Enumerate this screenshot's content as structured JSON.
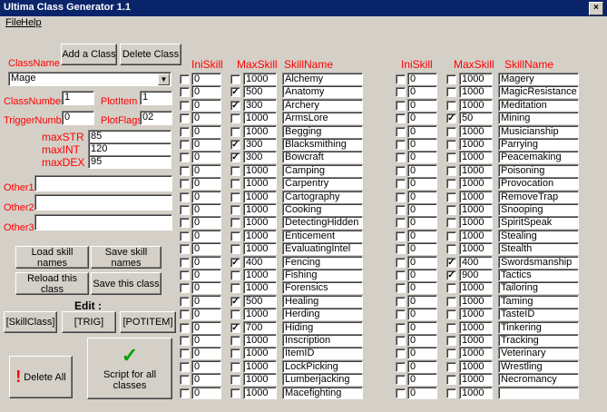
{
  "window": {
    "title": "Ultima Class Generator 1.1",
    "close_glyph": "×"
  },
  "menu": {
    "file": "File",
    "help": "Help"
  },
  "class_panel": {
    "add_class": "Add a Class",
    "delete_class": "Delete Class",
    "classname_label": "ClassName",
    "classname_value": "Mage",
    "classnumber_label": "ClassNumber",
    "classnumber_value": "1",
    "plotitem_label": "PlotItem",
    "plotitem_value": "1",
    "triggernumber_label": "TriggerNumber",
    "triggernumber_value": "0",
    "plotflags_label": "PlotFlags",
    "plotflags_value": "02",
    "maxstr_label": "maxSTR",
    "maxstr_value": "85",
    "maxint_label": "maxINT",
    "maxint_value": "120",
    "maxdex_label": "maxDEX",
    "maxdex_value": "95",
    "other1_label": "Other1",
    "other1_value": "",
    "other2_label": "Other2",
    "other2_value": "",
    "other3_label": "Other3",
    "other3_value": ""
  },
  "actions": {
    "load_skill_names": "Load skill names",
    "save_skill_names": "Save skill names",
    "reload_class": "Reload this class",
    "save_class": "Save this class",
    "edit_label": "Edit :",
    "skillclass": "[SkillClass]",
    "trig": "[TRIG]",
    "potitem": "[POTITEM]",
    "delete_all": "Delete All",
    "script_all": "Script for all classes"
  },
  "headers": {
    "iniskill": "IniSkill",
    "maxskill": "MaxSkill",
    "skillname": "SkillName"
  },
  "skills_left": [
    {
      "ini": "0",
      "max_checked": false,
      "max": "1000",
      "name": "Alchemy"
    },
    {
      "ini": "0",
      "max_checked": true,
      "max": "500",
      "name": "Anatomy"
    },
    {
      "ini": "0",
      "max_checked": true,
      "max": "300",
      "name": "Archery"
    },
    {
      "ini": "0",
      "max_checked": false,
      "max": "1000",
      "name": "ArmsLore"
    },
    {
      "ini": "0",
      "max_checked": false,
      "max": "1000",
      "name": "Begging"
    },
    {
      "ini": "0",
      "max_checked": true,
      "max": "300",
      "name": "Blacksmithing"
    },
    {
      "ini": "0",
      "max_checked": true,
      "max": "300",
      "name": "Bowcraft"
    },
    {
      "ini": "0",
      "max_checked": false,
      "max": "1000",
      "name": "Camping"
    },
    {
      "ini": "0",
      "max_checked": false,
      "max": "1000",
      "name": "Carpentry"
    },
    {
      "ini": "0",
      "max_checked": false,
      "max": "1000",
      "name": "Cartography"
    },
    {
      "ini": "0",
      "max_checked": false,
      "max": "1000",
      "name": "Cooking"
    },
    {
      "ini": "0",
      "max_checked": false,
      "max": "1000",
      "name": "DetectingHidden"
    },
    {
      "ini": "0",
      "max_checked": false,
      "max": "1000",
      "name": "Enticement"
    },
    {
      "ini": "0",
      "max_checked": false,
      "max": "1000",
      "name": "EvaluatingIntel"
    },
    {
      "ini": "0",
      "max_checked": true,
      "max": "400",
      "name": "Fencing"
    },
    {
      "ini": "0",
      "max_checked": false,
      "max": "1000",
      "name": "Fishing"
    },
    {
      "ini": "0",
      "max_checked": false,
      "max": "1000",
      "name": "Forensics"
    },
    {
      "ini": "0",
      "max_checked": true,
      "max": "500",
      "name": "Healing"
    },
    {
      "ini": "0",
      "max_checked": false,
      "max": "1000",
      "name": "Herding"
    },
    {
      "ini": "0",
      "max_checked": true,
      "max": "700",
      "name": "Hiding"
    },
    {
      "ini": "0",
      "max_checked": false,
      "max": "1000",
      "name": "Inscription"
    },
    {
      "ini": "0",
      "max_checked": false,
      "max": "1000",
      "name": "ItemID"
    },
    {
      "ini": "0",
      "max_checked": false,
      "max": "1000",
      "name": "LockPicking"
    },
    {
      "ini": "0",
      "max_checked": false,
      "max": "1000",
      "name": "Lumberjacking"
    },
    {
      "ini": "0",
      "max_checked": false,
      "max": "1000",
      "name": "Macefighting"
    }
  ],
  "skills_right": [
    {
      "ini": "0",
      "max_checked": false,
      "max": "1000",
      "name": "Magery"
    },
    {
      "ini": "0",
      "max_checked": false,
      "max": "1000",
      "name": "MagicResistance"
    },
    {
      "ini": "0",
      "max_checked": false,
      "max": "1000",
      "name": "Meditation"
    },
    {
      "ini": "0",
      "max_checked": true,
      "max": "50",
      "name": "Mining"
    },
    {
      "ini": "0",
      "max_checked": false,
      "max": "1000",
      "name": "Musicianship"
    },
    {
      "ini": "0",
      "max_checked": false,
      "max": "1000",
      "name": "Parrying"
    },
    {
      "ini": "0",
      "max_checked": false,
      "max": "1000",
      "name": "Peacemaking"
    },
    {
      "ini": "0",
      "max_checked": false,
      "max": "1000",
      "name": "Poisoning"
    },
    {
      "ini": "0",
      "max_checked": false,
      "max": "1000",
      "name": "Provocation"
    },
    {
      "ini": "0",
      "max_checked": false,
      "max": "1000",
      "name": "RemoveTrap"
    },
    {
      "ini": "0",
      "max_checked": false,
      "max": "1000",
      "name": "Snooping"
    },
    {
      "ini": "0",
      "max_checked": false,
      "max": "1000",
      "name": "SpiritSpeak"
    },
    {
      "ini": "0",
      "max_checked": false,
      "max": "1000",
      "name": "Stealing"
    },
    {
      "ini": "0",
      "max_checked": false,
      "max": "1000",
      "name": "Stealth"
    },
    {
      "ini": "0",
      "max_checked": true,
      "max": "400",
      "name": "Swordsmanship"
    },
    {
      "ini": "0",
      "max_checked": true,
      "max": "900",
      "name": "Tactics"
    },
    {
      "ini": "0",
      "max_checked": false,
      "max": "1000",
      "name": "Tailoring"
    },
    {
      "ini": "0",
      "max_checked": false,
      "max": "1000",
      "name": "Taming"
    },
    {
      "ini": "0",
      "max_checked": false,
      "max": "1000",
      "name": "TasteID"
    },
    {
      "ini": "0",
      "max_checked": false,
      "max": "1000",
      "name": "Tinkering"
    },
    {
      "ini": "0",
      "max_checked": false,
      "max": "1000",
      "name": "Tracking"
    },
    {
      "ini": "0",
      "max_checked": false,
      "max": "1000",
      "name": "Veterinary"
    },
    {
      "ini": "0",
      "max_checked": false,
      "max": "1000",
      "name": "Wrestling"
    },
    {
      "ini": "0",
      "max_checked": false,
      "max": "1000",
      "name": "Necromancy"
    },
    {
      "ini": "0",
      "max_checked": false,
      "max": "1000",
      "name": ""
    }
  ],
  "colors": {
    "label_red": "#ff0000",
    "titlebar": "#0a246a",
    "face": "#d4d0c8",
    "checkmark_green": "#00a000",
    "alert_red": "#ff0000"
  },
  "icons": {
    "checkmark": "check-icon",
    "exclamation": "exclamation-icon",
    "dropdown": "chevron-down-icon"
  }
}
